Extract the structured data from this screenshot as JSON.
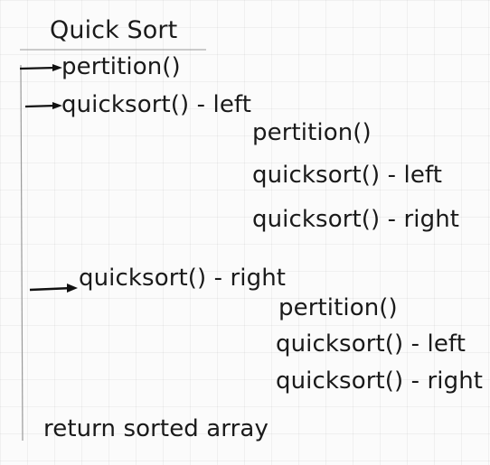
{
  "title": "Quick Sort",
  "steps": {
    "partition": "pertition()",
    "quicksort_left": "quicksort() - left",
    "left_branch": {
      "partition": "pertition()",
      "quicksort_left": "quicksort() - left",
      "quicksort_right": "quicksort() - right"
    },
    "quicksort_right": "quicksort() - right",
    "right_branch": {
      "partition": "pertition()",
      "quicksort_left": "quicksort() - left",
      "quicksort_right": "quicksort() - right"
    },
    "return": "return sorted array"
  },
  "colors": {
    "ink": "#1a1a1a",
    "line": "#9a9a9a",
    "grid": "#e8e8e8"
  }
}
